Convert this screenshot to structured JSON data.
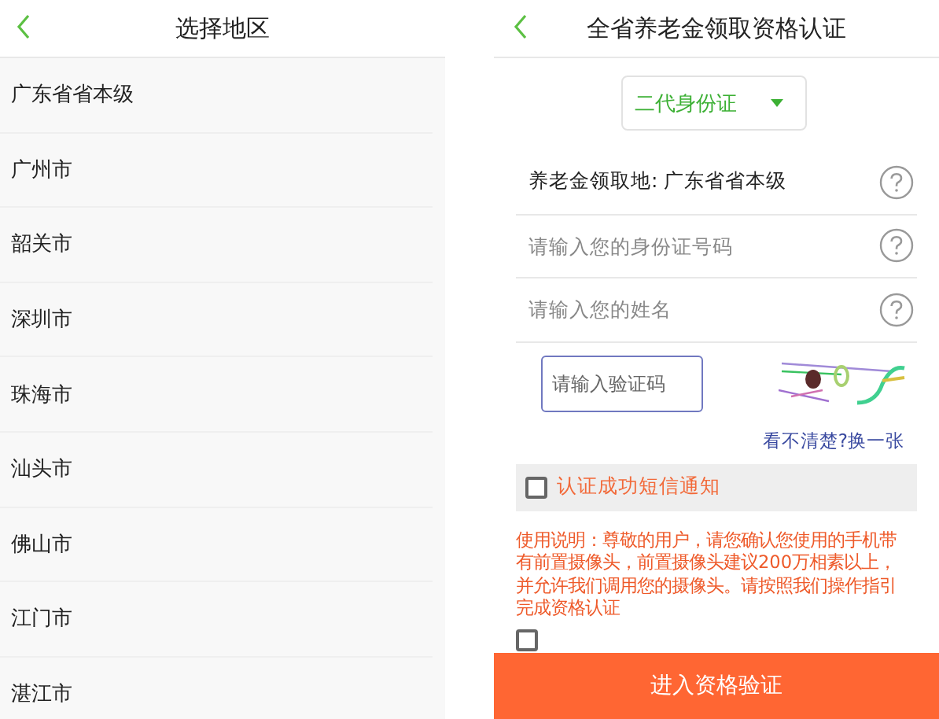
{
  "left_screen": {
    "title": "选择地区",
    "regions": [
      "广东省省本级",
      "广州市",
      "韶关市",
      "深圳市",
      "珠海市",
      "汕头市",
      "佛山市",
      "江门市",
      "湛江市"
    ]
  },
  "right_screen": {
    "title": "全省养老金领取资格认证",
    "id_type": "二代身份证",
    "rows": [
      {
        "kind": "value",
        "text": "养老金领取地: 广东省省本级"
      },
      {
        "kind": "input",
        "placeholder": "请输入您的身份证号码"
      },
      {
        "kind": "input",
        "placeholder": "请输入您的姓名"
      }
    ],
    "captcha": {
      "placeholder": "请输入验证码",
      "refresh_link": "看不清楚?换一张"
    },
    "sms_notice": {
      "label": "认证成功短信通知",
      "checked": false
    },
    "instructions": "使用说明：尊敬的用户，请您确认您使用的手机带有前置摄像头，前置摄像头建议200万相素以上，并允许我们调用您的摄像头。请按照我们操作指引完成资格认证",
    "guide_checkbox": {
      "checked": false
    },
    "submit_button": "进入资格验证"
  }
}
